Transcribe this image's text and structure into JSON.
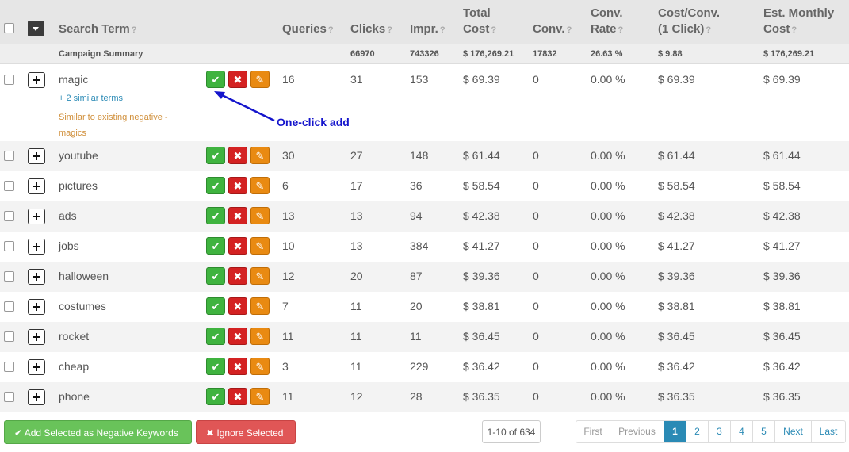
{
  "header": {
    "search_term": "Search Term",
    "queries": "Queries",
    "clicks": "Clicks",
    "impr": "Impr.",
    "total_cost_1": "Total",
    "total_cost_2": "Cost",
    "conv": "Conv.",
    "conv_rate_1": "Conv.",
    "conv_rate_2": "Rate",
    "cost_conv_1": "Cost/Conv.",
    "cost_conv_2": "(1 Click)",
    "est_1": "Est. Monthly",
    "est_2": "Cost",
    "help": "?"
  },
  "summary": {
    "label": "Campaign Summary",
    "clicks": "66970",
    "impr": "743326",
    "total_cost": "$ 176,269.21",
    "conv": "17832",
    "conv_rate": "26.63 %",
    "cost_conv": "$ 9.88",
    "est_cost": "$ 176,269.21"
  },
  "rows": [
    {
      "term": "magic",
      "queries": "16",
      "clicks": "31",
      "impr": "153",
      "total_cost": "$ 69.39",
      "conv": "0",
      "conv_rate": "0.00 %",
      "cost_conv": "$ 69.39",
      "est_cost": "$ 69.39",
      "similar": "+ 2 similar terms",
      "note": "Similar to existing negative - magics"
    },
    {
      "term": "youtube",
      "queries": "30",
      "clicks": "27",
      "impr": "148",
      "total_cost": "$ 61.44",
      "conv": "0",
      "conv_rate": "0.00 %",
      "cost_conv": "$ 61.44",
      "est_cost": "$ 61.44"
    },
    {
      "term": "pictures",
      "queries": "6",
      "clicks": "17",
      "impr": "36",
      "total_cost": "$ 58.54",
      "conv": "0",
      "conv_rate": "0.00 %",
      "cost_conv": "$ 58.54",
      "est_cost": "$ 58.54"
    },
    {
      "term": "ads",
      "queries": "13",
      "clicks": "13",
      "impr": "94",
      "total_cost": "$ 42.38",
      "conv": "0",
      "conv_rate": "0.00 %",
      "cost_conv": "$ 42.38",
      "est_cost": "$ 42.38"
    },
    {
      "term": "jobs",
      "queries": "10",
      "clicks": "13",
      "impr": "384",
      "total_cost": "$ 41.27",
      "conv": "0",
      "conv_rate": "0.00 %",
      "cost_conv": "$ 41.27",
      "est_cost": "$ 41.27"
    },
    {
      "term": "halloween",
      "queries": "12",
      "clicks": "20",
      "impr": "87",
      "total_cost": "$ 39.36",
      "conv": "0",
      "conv_rate": "0.00 %",
      "cost_conv": "$ 39.36",
      "est_cost": "$ 39.36"
    },
    {
      "term": "costumes",
      "queries": "7",
      "clicks": "11",
      "impr": "20",
      "total_cost": "$ 38.81",
      "conv": "0",
      "conv_rate": "0.00 %",
      "cost_conv": "$ 38.81",
      "est_cost": "$ 38.81"
    },
    {
      "term": "rocket",
      "queries": "11",
      "clicks": "11",
      "impr": "11",
      "total_cost": "$ 36.45",
      "conv": "0",
      "conv_rate": "0.00 %",
      "cost_conv": "$ 36.45",
      "est_cost": "$ 36.45"
    },
    {
      "term": "cheap",
      "queries": "3",
      "clicks": "11",
      "impr": "229",
      "total_cost": "$ 36.42",
      "conv": "0",
      "conv_rate": "0.00 %",
      "cost_conv": "$ 36.42",
      "est_cost": "$ 36.42"
    },
    {
      "term": "phone",
      "queries": "11",
      "clicks": "12",
      "impr": "28",
      "total_cost": "$ 36.35",
      "conv": "0",
      "conv_rate": "0.00 %",
      "cost_conv": "$ 36.35",
      "est_cost": "$ 36.35"
    }
  ],
  "annotation": "One-click add",
  "footer": {
    "add_selected": "Add Selected as Negative Keywords",
    "ignore_selected": "Ignore Selected",
    "range": "1-10 of 634",
    "pager": {
      "first": "First",
      "previous": "Previous",
      "pages": [
        "1",
        "2",
        "3",
        "4",
        "5"
      ],
      "next": "Next",
      "last": "Last",
      "active_page": "1"
    }
  },
  "icons": {
    "check": "check-icon",
    "remove": "x-icon",
    "edit": "pencil-icon",
    "expand": "plus-icon",
    "dropdown": "caret-down-icon"
  },
  "colors": {
    "accept": "#3fb33f",
    "reject": "#d42222",
    "edit": "#e98a12",
    "link": "#2a8ab5",
    "warning_note": "#d08f3a",
    "annotation": "#1515cc",
    "pager_active": "#2a8ab5"
  }
}
